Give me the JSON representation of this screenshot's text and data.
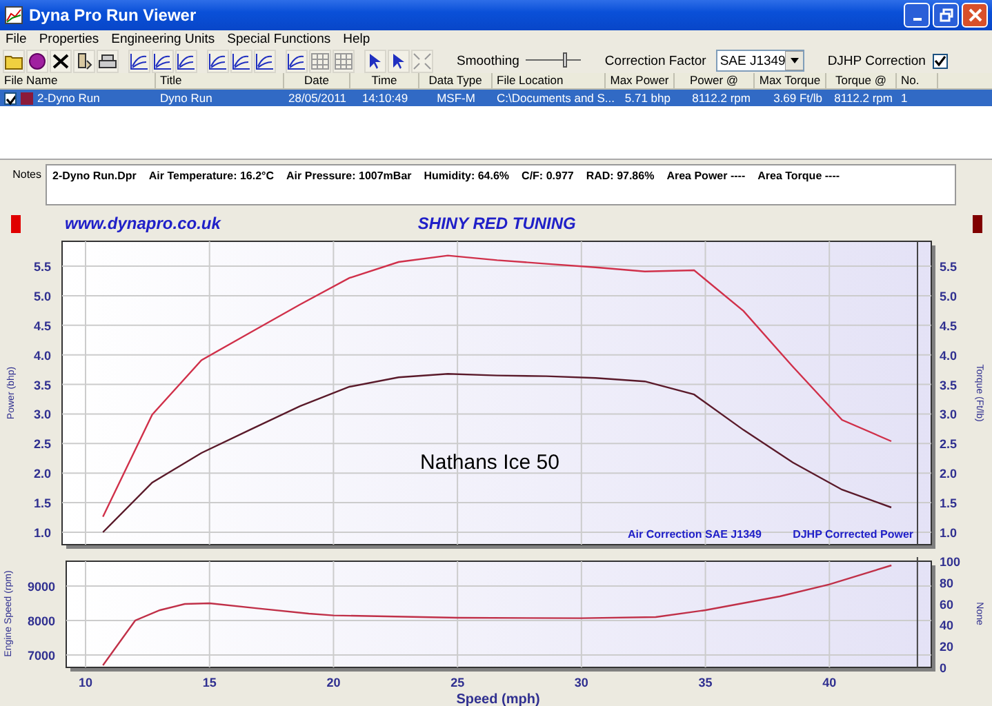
{
  "window": {
    "title": "Dyna Pro Run Viewer"
  },
  "menu": [
    "File",
    "Properties",
    "Engineering Units",
    "Special Functions",
    "Help"
  ],
  "toolbar": {
    "smoothing": {
      "label": "Smoothing",
      "level": 0.75
    },
    "correction_factor": {
      "label": "Correction Factor",
      "value": "SAE J1349"
    },
    "djhp_correction": {
      "label": "DJHP Correction",
      "checked": true
    }
  },
  "runs": {
    "columns": [
      "File Name",
      "Title",
      "Date",
      "Time",
      "Data Type",
      "File Location",
      "Max Power",
      "Power @",
      "Max Torque",
      "Torque @",
      "No."
    ],
    "rows": [
      {
        "checked": true,
        "selected": true,
        "color": "#8b1a3a",
        "cells": [
          "2-Dyno Run",
          "Dyno Run",
          "28/05/2011",
          "14:10:49",
          "MSF-M",
          "C:\\Documents and S...",
          "5.71 bhp",
          "8112.2 rpm",
          "3.69 Ft/lb",
          "8112.2 rpm",
          "1"
        ]
      }
    ]
  },
  "notes": {
    "label": "Notes",
    "items": [
      "2-Dyno Run.Dpr",
      "Air Temperature: 16.2°C",
      "Air Pressure: 1007mBar",
      "Humidity: 64.6%",
      "C/F: 0.977",
      "RAD: 97.86%",
      "Area Power ----",
      "Area Torque ----"
    ]
  },
  "header": {
    "website": "www.dynapro.co.uk",
    "title": "SHINY RED TUNING"
  },
  "power_chart": {
    "chart_data": {
      "type": "line",
      "ylabel": "Power (bhp)",
      "y2label": "Torque (Ft/lb)",
      "categories": [
        null,
        null,
        null,
        null,
        null,
        null,
        null,
        null,
        null,
        null,
        null,
        null,
        null,
        null,
        null,
        null,
        null
      ],
      "series": [
        {
          "color": "#d0304a",
          "values": [
            1.26,
            2.99,
            3.91,
            4.38,
            4.85,
            5.3,
            5.57,
            5.68,
            5.6,
            5.54,
            5.48,
            5.41,
            5.43,
            4.74,
            3.8,
            2.9,
            2.54
          ]
        },
        {
          "color": "#5a1a2a",
          "values": [
            1.0,
            1.84,
            2.34,
            2.74,
            3.13,
            3.46,
            3.62,
            3.68,
            3.65,
            3.64,
            3.61,
            3.55,
            3.33,
            2.73,
            2.18,
            1.72,
            1.42
          ]
        }
      ],
      "ylim": [
        0.79,
        5.92
      ],
      "y2lim": [
        0.79,
        5.92
      ],
      "grid": true,
      "yticks": [
        {
          "value": 1,
          "label": "1.0"
        },
        {
          "value": 1.5,
          "label": "1.5"
        },
        {
          "value": 2,
          "label": "2.0"
        },
        {
          "value": 2.5,
          "label": "2.5"
        },
        {
          "value": 3,
          "label": "3.0"
        },
        {
          "value": 3.5,
          "label": "3.5"
        },
        {
          "value": 4,
          "label": "4.0"
        },
        {
          "value": 4.5,
          "label": "4.5"
        },
        {
          "value": 5,
          "label": "5.0"
        },
        {
          "value": 5.5,
          "label": "5.5"
        }
      ],
      "y2ticks": [
        {
          "value": 1,
          "label": "1.0"
        },
        {
          "value": 1.5,
          "label": "1.5"
        },
        {
          "value": 2,
          "label": "2.0"
        },
        {
          "value": 2.5,
          "label": "2.5"
        },
        {
          "value": 3,
          "label": "3.0"
        },
        {
          "value": 3.5,
          "label": "3.5"
        },
        {
          "value": 4,
          "label": "4.0"
        },
        {
          "value": 4.5,
          "label": "4.5"
        },
        {
          "value": 5,
          "label": "5.0"
        },
        {
          "value": 5.5,
          "label": "5.5"
        }
      ],
      "title": "Nathans Ice 50",
      "annotations": [
        {
          "text": "Air Correction SAE J1349"
        },
        {
          "text": "DJHP Corrected Power"
        }
      ]
    }
  },
  "speed_chart": {
    "chart_data": {
      "type": "line",
      "xlabel": "Speed (mph)",
      "ylabel": "Engine Speed (rpm)",
      "y2label": "None",
      "x": [
        10.7,
        12,
        13,
        14,
        15,
        17,
        19,
        20,
        25,
        30,
        33,
        35,
        38,
        40,
        42.5
      ],
      "series": [
        {
          "color": "#c03048",
          "values": [
            6700,
            8000,
            8300,
            8480,
            8500,
            8350,
            8200,
            8150,
            8080,
            8070,
            8100,
            8300,
            8700,
            9050,
            9600
          ]
        }
      ],
      "xlim": [
        9.22,
        44.11
      ],
      "ylim": [
        6640,
        9720
      ],
      "ref_lines": [
        {
          "axis": "x",
          "value": 43.55
        }
      ],
      "y2lim": [
        0,
        100
      ],
      "grid": true,
      "xticks": [
        10,
        15,
        20,
        25,
        30,
        35,
        40
      ],
      "yticks": [
        7000,
        8000,
        9000
      ],
      "y2ticks": [
        0,
        20,
        40,
        60,
        80,
        100
      ]
    }
  }
}
